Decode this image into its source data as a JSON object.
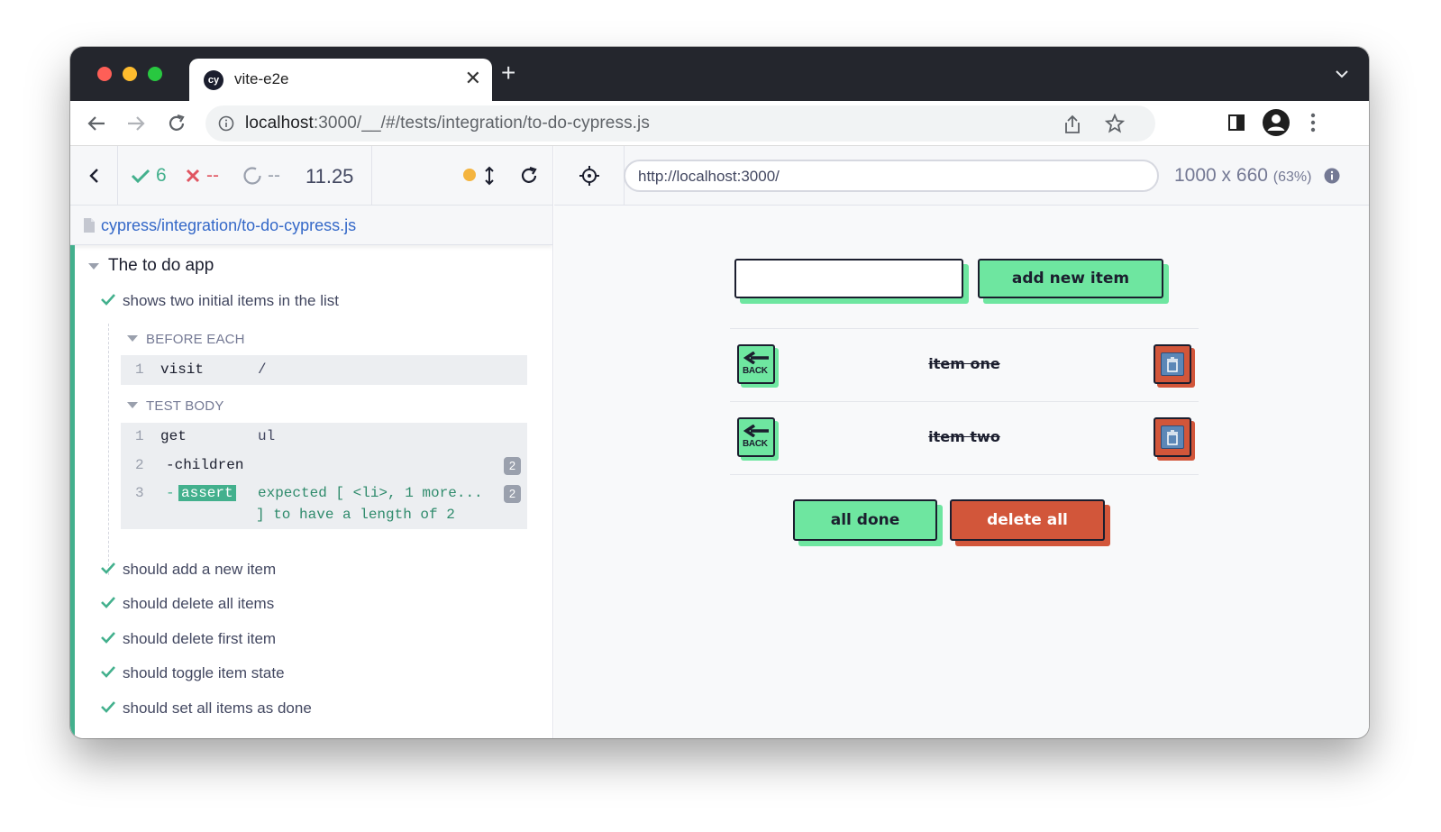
{
  "browser": {
    "tab_title": "vite-e2e",
    "tab_favicon_text": "cy",
    "url_host": "localhost",
    "url_rest": ":3000/__/#/tests/integration/to-do-cypress.js"
  },
  "reporter": {
    "stats": {
      "passed": "6",
      "failed": "--",
      "pending": "--",
      "duration": "11.25"
    },
    "spec_path": "cypress/integration/to-do-cypress.js",
    "suite_title": "The to do app",
    "open_test": "shows two initial items in the list",
    "hooks": {
      "before_each_label": "BEFORE EACH",
      "test_body_label": "TEST BODY"
    },
    "before_each_commands": [
      {
        "num": "1",
        "name": "visit",
        "message": "/"
      }
    ],
    "test_body_commands": [
      {
        "num": "1",
        "name": "get",
        "message": "ul"
      },
      {
        "num": "2",
        "name": "-children",
        "message": "",
        "badge": "2"
      },
      {
        "num": "3",
        "name_prefix": "-",
        "name": "assert",
        "message_line1": "expected [ <li>, 1 more...",
        "message_line2": "] to have a length of 2",
        "badge": "2"
      }
    ],
    "other_tests": [
      "should add a new item",
      "should delete all items",
      "should delete first item",
      "should toggle item state",
      "should set all items as done"
    ]
  },
  "aut": {
    "url": "http://localhost:3000/",
    "viewport": "1000 x 660",
    "scale": "(63%)",
    "new_item_input_value": "",
    "add_button_label": "add new item",
    "items": [
      {
        "text": "item one",
        "back_label": "BACK",
        "done": true
      },
      {
        "text": "item two",
        "back_label": "BACK",
        "done": true
      }
    ],
    "all_done_label": "all done",
    "delete_all_label": "delete all"
  },
  "colors": {
    "pass": "#43b08d",
    "fail": "#e05561",
    "running": "#f4b43f",
    "link": "#3468c8",
    "app_green": "#6ee6a0",
    "app_red": "#d2563a"
  }
}
